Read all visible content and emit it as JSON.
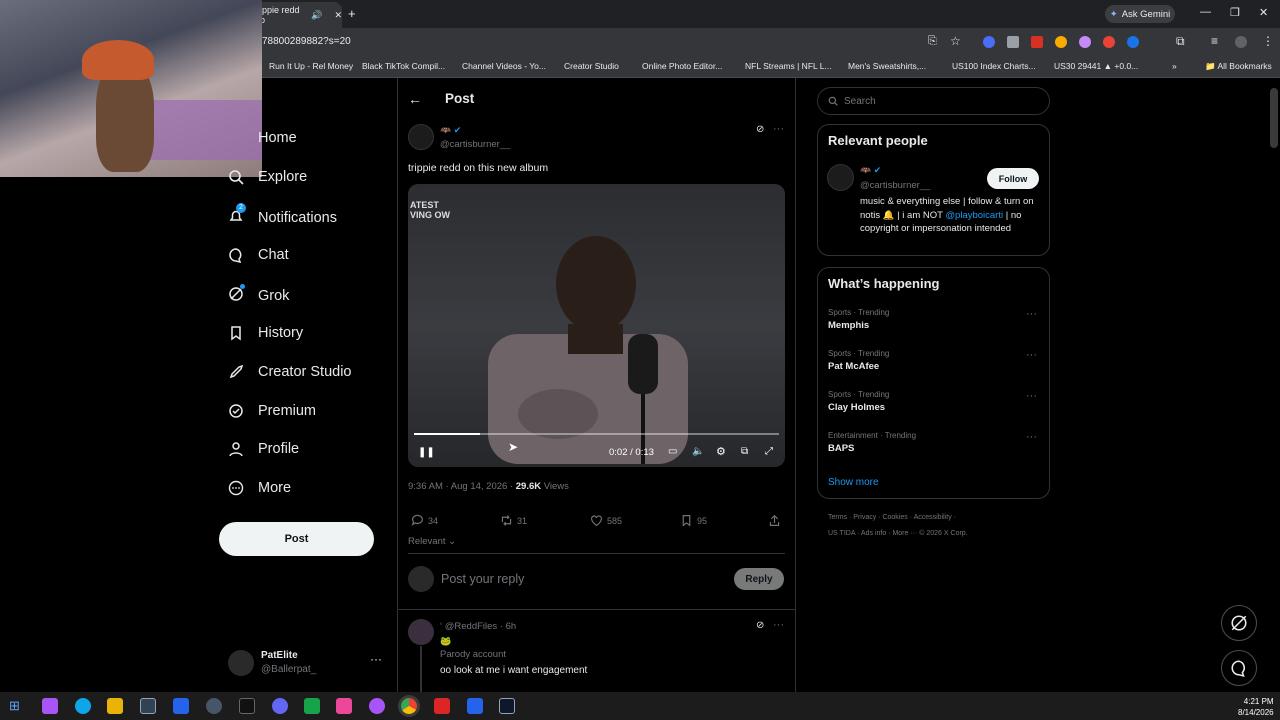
{
  "browser": {
    "tab_title": "ippie redd o",
    "url": "78800289882?s=20",
    "ask_label": "Ask Gemini",
    "bookmarks": [
      "Run It Up - Rel Money",
      "Black TikTok Compil...",
      "Channel Videos - Yo...",
      "Creator Studio",
      "Online Photo Editor...",
      "NFL Streams | NFL L...",
      "Men's Sweatshirts,...",
      "US100 Index Charts...",
      "US30 29441 ▲ +0.0..."
    ],
    "all_bookmarks": "All Bookmarks"
  },
  "nav": {
    "items": [
      "Home",
      "Explore",
      "Notifications",
      "Chat",
      "Grok",
      "History",
      "Creator Studio",
      "Premium",
      "Profile",
      "More"
    ],
    "notif_badge": "2",
    "post_label": "Post",
    "account_name": "PatElite",
    "account_handle": "@Ballerpat_"
  },
  "post": {
    "header": "Post",
    "handle": "@cartisburner__",
    "text": "trippie redd on this new album",
    "video_caption": "ATEST VING OW",
    "time_display": "0:02 / 0:13",
    "progress": 0.18,
    "timestamp": "9:36 AM · Aug 14, 2026 ·",
    "views_count": "29.6K",
    "views_label": "Views",
    "replies": "34",
    "reposts": "31",
    "likes": "585",
    "bookmarks": "95",
    "sort": "Relevant",
    "reply_placeholder": "Post your reply",
    "reply_button": "Reply"
  },
  "reply": {
    "handle": "@ReddFiles · 6h",
    "parody": "Parody account",
    "text": "oo look at me i want engagement"
  },
  "sidebar": {
    "search_placeholder": "Search",
    "relevant_title": "Relevant people",
    "person_handle": "@cartisburner__",
    "follow": "Follow",
    "bio_1": "music & everything else | follow & turn on notis 🔔 | i am NOT ",
    "bio_mention": "@playboicarti",
    "bio_2": " | no copyright or impersonation intended",
    "happening_title": "What’s happening",
    "trends": [
      {
        "meta": "Sports · Trending",
        "name": "Memphis"
      },
      {
        "meta": "Sports · Trending",
        "name": "Pat McAfee"
      },
      {
        "meta": "Sports · Trending",
        "name": "Clay Holmes"
      },
      {
        "meta": "Entertainment · Trending",
        "name": "BAPS"
      }
    ],
    "show_more": "Show more",
    "footer_1": "Terms  ·  Privacy  ·  Cookies  ·  Accessibility  ·",
    "footer_2": "US TIDA  ·  Ads info  ·  More ···  © 2026 X Corp."
  },
  "taskbar": {
    "time": "4:21 PM",
    "date": "8/14/2026"
  },
  "colors": {
    "accent": "#1d9bf0",
    "bg": "#000000",
    "border": "#2f3336"
  }
}
